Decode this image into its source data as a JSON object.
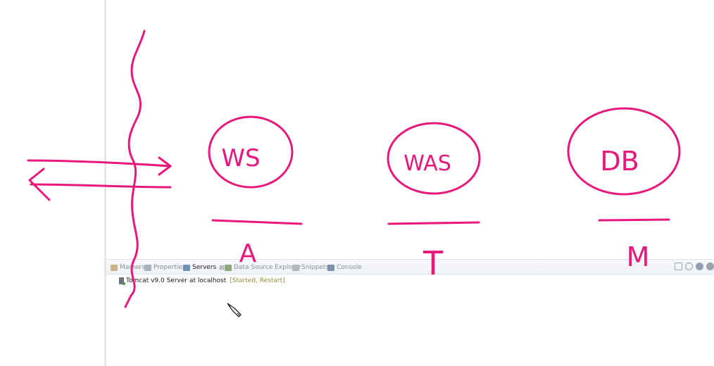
{
  "bottom_panel": {
    "tabs": [
      {
        "label": "Markers",
        "icon": "markers-icon",
        "active": false
      },
      {
        "label": "Properties",
        "icon": "properties-icon",
        "active": false
      },
      {
        "label": "Servers",
        "icon": "servers-icon",
        "active": true
      },
      {
        "label": "Data Source Explorer",
        "icon": "data-source-explorer-icon",
        "active": false
      },
      {
        "label": "Snippets",
        "icon": "snippets-icon",
        "active": false
      },
      {
        "label": "Console",
        "icon": "console-icon",
        "active": false
      }
    ],
    "close_glyph": "☒",
    "server": {
      "name": "Tomcat v9.0 Server at localhost",
      "status": "[Started, Restart]"
    },
    "view_tools": [
      "minimize-icon",
      "settings-icon",
      "run-icon",
      "stop-icon"
    ]
  },
  "annotation": {
    "color": "#e8177c",
    "nodes": [
      {
        "circle_label": "WS",
        "under_label": "A"
      },
      {
        "circle_label": "WAS",
        "under_label": "T"
      },
      {
        "circle_label": "DB",
        "under_label": "M"
      }
    ]
  }
}
